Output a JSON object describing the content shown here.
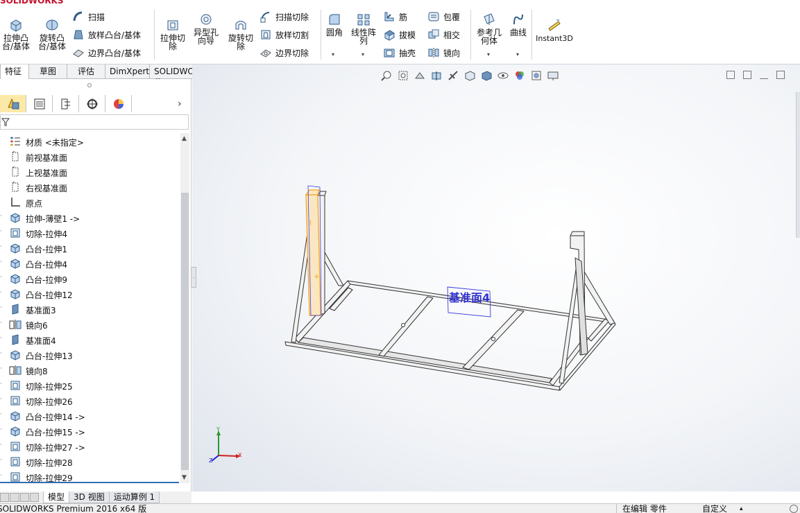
{
  "app": {
    "logo_text": "SOLIDWORKS"
  },
  "ribbon": {
    "extrude_boss": "拉伸凸台/基体",
    "revolve_boss": "旋转凸台/基体",
    "sweep": "扫描",
    "loft": "放样凸台/基体",
    "boundary_boss": "边界凸台/基体",
    "extrude_cut": "拉伸切除",
    "hole_wizard": "异型孔向导",
    "revolve_cut": "旋转切除",
    "swept_cut": "扫描切除",
    "lofted_cut": "放样切割",
    "boundary_cut": "边界切除",
    "fillet": "圆角",
    "linear_pattern": "线性阵列",
    "rib": "筋",
    "draft": "拔模",
    "shell": "抽壳",
    "wrap": "包覆",
    "intersect": "相交",
    "mirror": "镜向",
    "ref_geometry": "参考几何体",
    "curves": "曲线",
    "instant3d": "Instant3D"
  },
  "tabs": [
    "特征",
    "草图",
    "评估",
    "DimXpert",
    "SOLIDWORKS 插件"
  ],
  "feature_tree": [
    {
      "label": "材质 <未指定>",
      "icon": "material-icon"
    },
    {
      "label": "前视基准面",
      "icon": "plane-icon"
    },
    {
      "label": "上视基准面",
      "icon": "plane-icon"
    },
    {
      "label": "右视基准面",
      "icon": "plane-icon"
    },
    {
      "label": "原点",
      "icon": "origin-icon"
    },
    {
      "label": "拉伸-薄壁1 ->",
      "icon": "extrude-icon"
    },
    {
      "label": "切除-拉伸4",
      "icon": "cut-icon"
    },
    {
      "label": "凸台-拉伸1",
      "icon": "extrude-icon"
    },
    {
      "label": "凸台-拉伸4",
      "icon": "extrude-icon"
    },
    {
      "label": "凸台-拉伸9",
      "icon": "extrude-icon"
    },
    {
      "label": "凸台-拉伸12",
      "icon": "extrude-icon"
    },
    {
      "label": "基准面3",
      "icon": "refplane-icon"
    },
    {
      "label": "镜向6",
      "icon": "mirror-icon"
    },
    {
      "label": "基准面4",
      "icon": "refplane-icon"
    },
    {
      "label": "凸台-拉伸13",
      "icon": "extrude-icon"
    },
    {
      "label": "镜向8",
      "icon": "mirror-icon"
    },
    {
      "label": "切除-拉伸25",
      "icon": "cut-icon"
    },
    {
      "label": "切除-拉伸26",
      "icon": "cut-icon"
    },
    {
      "label": "凸台-拉伸14 ->",
      "icon": "extrude-icon"
    },
    {
      "label": "凸台-拉伸15 ->",
      "icon": "extrude-icon"
    },
    {
      "label": "切除-拉伸27 ->",
      "icon": "cut-icon"
    },
    {
      "label": "切除-拉伸28",
      "icon": "cut-icon"
    },
    {
      "label": "切除-拉伸29",
      "icon": "cut-icon"
    }
  ],
  "bottom_tabs": [
    "模型",
    "3D 视图",
    "运动算例 1"
  ],
  "status": {
    "left": "SOLIDWORKS Premium 2016 x64 版",
    "mode": "在编辑 零件",
    "custom": "自定义"
  },
  "viewport": {
    "plane_label": "基准面4"
  },
  "triad": {
    "x": "X",
    "y": "Y",
    "z": "Z"
  },
  "colors": {
    "accent_orange": "#f5a623",
    "plane_blue": "#3030d0",
    "selected_tab": "#fce9a8"
  }
}
